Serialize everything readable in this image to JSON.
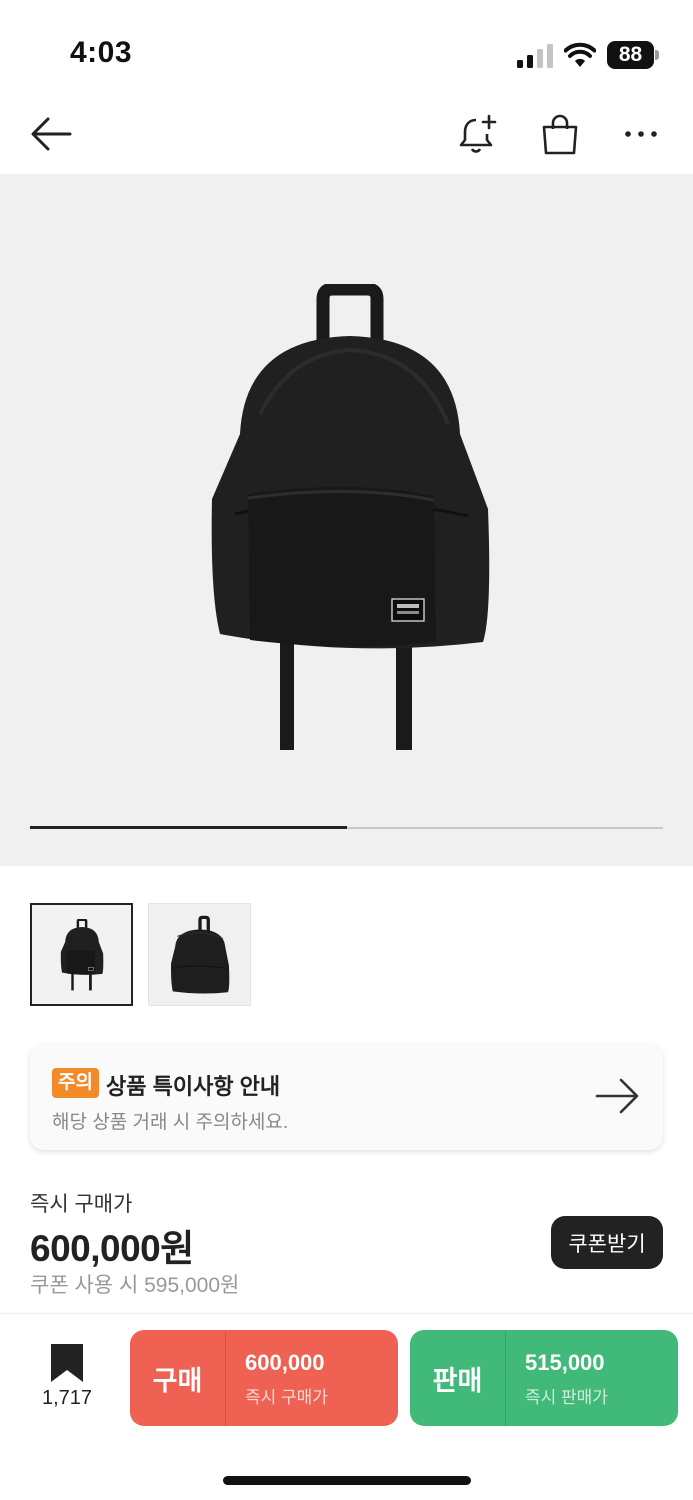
{
  "status_bar": {
    "time": "4:03",
    "battery": "88",
    "icons": [
      "cellular-signal-icon",
      "wifi-icon",
      "battery-icon"
    ]
  },
  "header": {
    "icons": [
      "back-arrow-icon",
      "bell-plus-icon",
      "shopping-bag-icon",
      "more-dots-icon"
    ]
  },
  "gallery": {
    "image_count": 2,
    "current_index": 1,
    "progress_fraction": 0.5
  },
  "notice": {
    "badge": "주의",
    "title": "상품 특이사항 안내",
    "subtitle": "해당 상품 거래 시 주의하세요.",
    "colors": {
      "badge": "#f28a27"
    }
  },
  "price": {
    "label": "즉시 구매가",
    "value": "600,000원",
    "coupon_note": "쿠폰 사용 시 595,000원",
    "coupon_button": "쿠폰받기"
  },
  "bottom_bar": {
    "wish_count": "1,717",
    "buy": {
      "label": "구매",
      "price": "600,000",
      "sub": "즉시 구매가",
      "color": "#ef6253"
    },
    "sell": {
      "label": "판매",
      "price": "515,000",
      "sub": "즉시 판매가",
      "color": "#41b979"
    }
  }
}
